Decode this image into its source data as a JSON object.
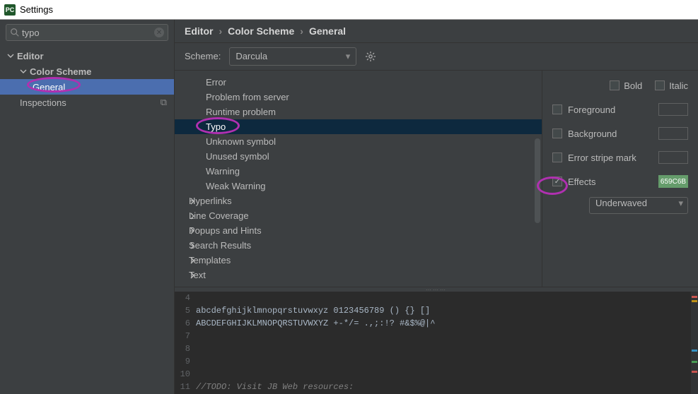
{
  "window": {
    "title": "Settings"
  },
  "search": {
    "value": "typo"
  },
  "sidebar": {
    "items": [
      {
        "label": "Editor",
        "expanded": true,
        "depth": 0
      },
      {
        "label": "Color Scheme",
        "expanded": true,
        "depth": 1
      },
      {
        "label": "General",
        "selected": true,
        "depth": 2
      },
      {
        "label": "Inspections",
        "depth": 1,
        "copy": true
      }
    ]
  },
  "breadcrumb": [
    "Editor",
    "Color Scheme",
    "General"
  ],
  "scheme": {
    "label": "Scheme:",
    "value": "Darcula"
  },
  "categories": {
    "top": [
      "Error",
      "Problem from server",
      "Runtime problem",
      "Typo",
      "Unknown symbol",
      "Unused symbol",
      "Warning",
      "Weak Warning"
    ],
    "selected": "Typo",
    "groups": [
      "Hyperlinks",
      "Line Coverage",
      "Popups and Hints",
      "Search Results",
      "Templates",
      "Text"
    ]
  },
  "props": {
    "bold": "Bold",
    "italic": "Italic",
    "foreground": "Foreground",
    "background": "Background",
    "errorstripe": "Error stripe mark",
    "effects": "Effects",
    "effects_color": "659C6B",
    "effects_type": "Underwaved"
  },
  "preview": {
    "lines": [
      {
        "n": 4,
        "t": ""
      },
      {
        "n": 5,
        "t": "abcdefghijklmnopqrstuvwxyz 0123456789 () {} []"
      },
      {
        "n": 6,
        "t": "ABCDEFGHIJKLMNOPQRSTUVWXYZ +-*/= .,;:!? #&$%@|^"
      },
      {
        "n": 7,
        "t": ""
      },
      {
        "n": 8,
        "t": ""
      },
      {
        "n": 9,
        "t": ""
      },
      {
        "n": 10,
        "t": ""
      },
      {
        "n": 11,
        "t": "//TODO: Visit JB Web resources:",
        "cls": "italic"
      }
    ]
  }
}
